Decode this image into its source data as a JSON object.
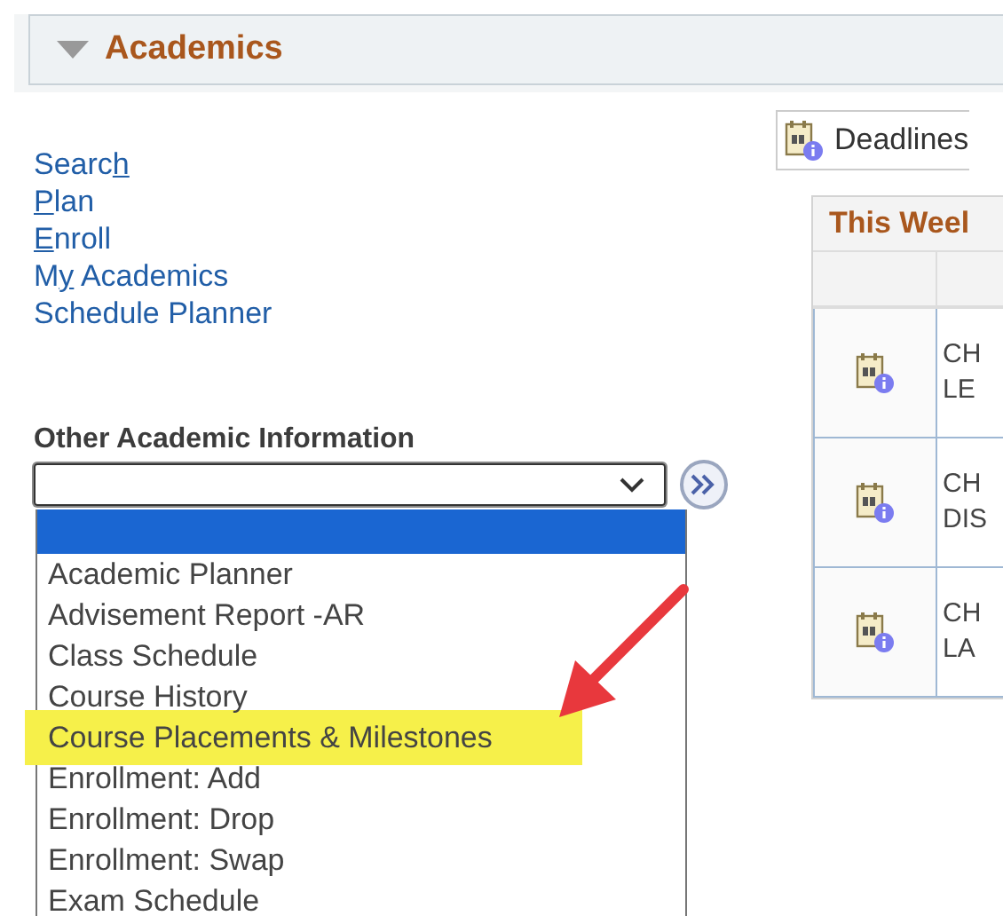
{
  "section": {
    "title": "Academics",
    "expanded": true
  },
  "links": [
    {
      "before": "Searc",
      "key": "h"
    },
    {
      "key": "P",
      "after": "lan"
    },
    {
      "key": "E",
      "after": "nroll"
    },
    {
      "before": "M",
      "key": "y",
      "after": " Academics"
    },
    {
      "before": "Schedule Planner"
    }
  ],
  "other_info": {
    "label": "Other Academic Information",
    "open": true,
    "options": [
      {
        "selected": true,
        "highlighted": false
      },
      {
        "label": "Academic Planner",
        "selected": false,
        "highlighted": false
      },
      {
        "label": "Advisement Report -AR",
        "selected": false,
        "highlighted": false
      },
      {
        "label": "Class Schedule",
        "selected": false,
        "highlighted": false
      },
      {
        "label": "Course History",
        "selected": false,
        "highlighted": false
      },
      {
        "label": "Course Placements & Milestones",
        "selected": false,
        "highlighted": true
      },
      {
        "label": "Enrollment: Add",
        "selected": false,
        "highlighted": false
      },
      {
        "label": "Enrollment: Drop",
        "selected": false,
        "highlighted": false
      },
      {
        "label": "Enrollment: Swap",
        "selected": false,
        "highlighted": false
      },
      {
        "label": "Exam Schedule",
        "selected": false,
        "highlighted": false
      }
    ]
  },
  "deadlines_button": {
    "label": "Deadlines"
  },
  "this_week": {
    "title": "This Weel",
    "rows": [
      {
        "lines": [
          "CH",
          "LE"
        ]
      },
      {
        "lines": [
          "CH",
          "DIS"
        ]
      },
      {
        "lines": [
          "CH",
          "LA"
        ]
      }
    ]
  }
}
